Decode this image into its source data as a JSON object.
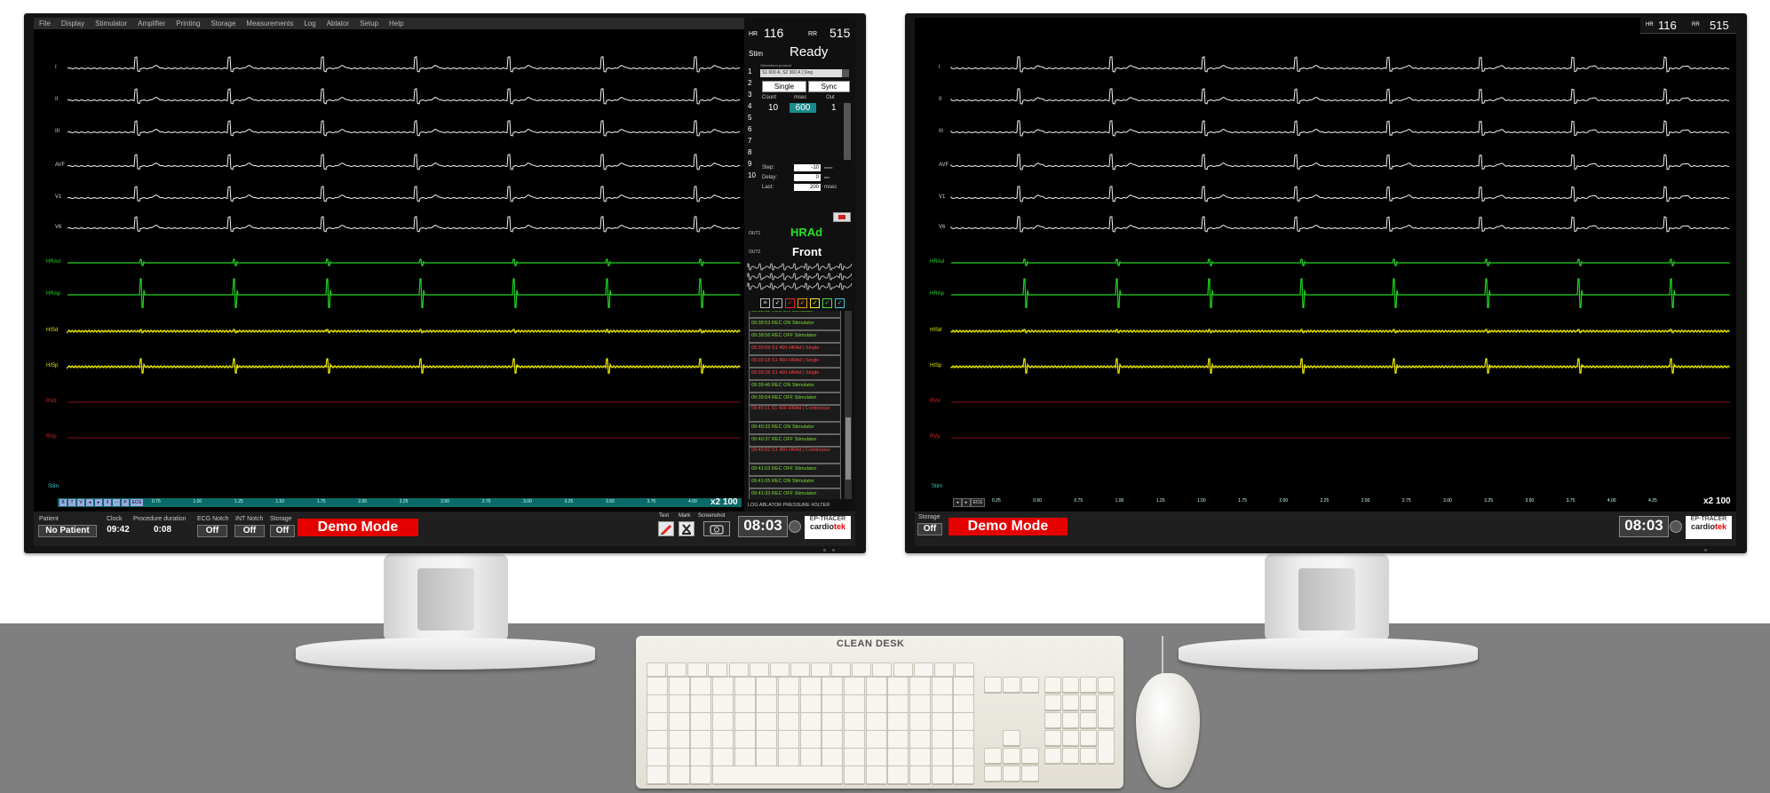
{
  "left_monitor": {
    "menu": [
      "File",
      "Display",
      "Stimulator",
      "Amplifier",
      "Printing",
      "Storage",
      "Measurements",
      "Log",
      "Ablator",
      "Setup",
      "Help"
    ],
    "ecg_channels": [
      "I",
      "II",
      "III",
      "AVF",
      "V1",
      "V6"
    ],
    "ic_channels": [
      {
        "label": "HRAd",
        "color": "green"
      },
      {
        "label": "HRAp",
        "color": "green"
      },
      {
        "label": "HISd",
        "color": "yellow"
      },
      {
        "label": "HISp",
        "color": "yellow"
      },
      {
        "label": "RVd",
        "color": "red"
      },
      {
        "label": "RVp",
        "color": "red"
      }
    ],
    "stim_label": "Stim",
    "timebar_buttons": [
      "B",
      "T",
      "V",
      "◂",
      "▸",
      "‖",
      "⋯",
      "P",
      "ECG"
    ],
    "time_ticks": [
      "0.75",
      "1.00",
      "1.25",
      "1.50",
      "1.75",
      "2.00",
      "2.25",
      "2.50",
      "2.75",
      "3.00",
      "3.25",
      "3.50",
      "3.75",
      "4.00"
    ],
    "zoom": {
      "factor": "x2",
      "value": "100"
    },
    "status": {
      "patient_caption": "Patient",
      "patient_value": "No Patient",
      "clock_caption": "Clock",
      "clock_value": "09:42",
      "duration_caption": "Procedure duration",
      "duration_value": "0:08",
      "ecg_notch_caption": "ECG Notch",
      "ecg_notch_value": "Off",
      "int_notch_caption": "INT Notch",
      "int_notch_value": "Off",
      "storage_caption": "Storage",
      "storage_value": "Off",
      "demo": "Demo Mode",
      "text_caption": "Text",
      "mark_caption": "Mark",
      "screenshot_caption": "Screenshot",
      "time": "08:03",
      "logo_top": "EP-TRACER",
      "logo_brand_a": "cardio",
      "logo_brand_b": "tek"
    },
    "panel": {
      "hr_label": "HR",
      "hr_value": "116",
      "rr_label": "RR",
      "rr_value": "515",
      "stim_label": "Stim",
      "stim_state": "Ready",
      "protocol_caption": "Stimulation protocol",
      "protocol": "S1 600 A, S2 360 A | Sing",
      "single": "Single",
      "sync": "Sync",
      "count_caption": "Count",
      "msec_caption": "msec",
      "out_caption": "Out",
      "count_value": "10",
      "msec_value": "600",
      "out_value": "1",
      "rows": [
        "1",
        "2",
        "3",
        "4",
        "5",
        "6",
        "7",
        "8",
        "9",
        "10"
      ],
      "step_caption": "Step:",
      "step_value": "-10",
      "step_unit": "msec",
      "delay_caption": "Delay:",
      "delay_value": "0",
      "delay_unit": "sec",
      "last_caption": "Last:",
      "last_value": "200",
      "last_unit": "msec",
      "out1_caption": "OUT1",
      "out1_value": "HRAd",
      "out2_caption": "OUT2",
      "out2_value": "Front",
      "tabs": "LOG  ABLATOR  PRESSURE  #OLTER",
      "log": [
        {
          "text": "09:38:53 REC ON Stimulator",
          "color": "green"
        },
        {
          "text": "09:38:56 REC OFF Stimulator",
          "color": "green"
        },
        {
          "text": "09:39:09 S1 400 HRAd | Single",
          "color": "red"
        },
        {
          "text": "09:39:18 S1 400 HRAd | Single",
          "color": "red"
        },
        {
          "text": "09:39:28 S1 400 HRAd | Single",
          "color": "red"
        },
        {
          "text": "09:39:46 REC ON Stimulator",
          "color": "green"
        },
        {
          "text": "09:39:54 REC OFF Stimulator",
          "color": "green"
        },
        {
          "text": "09:40:11 S1 400 HRAd | Continuous",
          "color": "red",
          "double": true
        },
        {
          "text": "09:40:32 REC ON Stimulator",
          "color": "green"
        },
        {
          "text": "09:40:37 REC OFF Stimulator",
          "color": "green"
        },
        {
          "text": "09:40:52 S1 400 HRAd | Continuous",
          "color": "red",
          "double": true
        },
        {
          "text": "09:41:03 REC OFF Stimulator",
          "color": "green"
        },
        {
          "text": "09:41:05 REC ON Stimulator",
          "color": "green"
        },
        {
          "text": "09:41:33 REC OFF Stimulator",
          "color": "green"
        }
      ],
      "log_first_partial": "09:38:11 REC ON Stimulator"
    }
  },
  "right_monitor": {
    "hr_label": "HR",
    "hr_value": "116",
    "rr_label": "RR",
    "rr_value": "515",
    "ecg_channels": [
      "I",
      "II",
      "III",
      "AVF",
      "V1",
      "V6"
    ],
    "ic_channels": [
      {
        "label": "HRAd",
        "color": "green"
      },
      {
        "label": "HRAp",
        "color": "green"
      },
      {
        "label": "HISd",
        "color": "yellow"
      },
      {
        "label": "HISp",
        "color": "yellow"
      },
      {
        "label": "RVd",
        "color": "red"
      },
      {
        "label": "RVp",
        "color": "red"
      }
    ],
    "stim_label": "Stim",
    "timebar_buttons": [
      "◂",
      "▸",
      "ECG"
    ],
    "time_ticks": [
      "0.25",
      "0.50",
      "0.75",
      "1.00",
      "1.25",
      "1.50",
      "1.75",
      "2.00",
      "2.25",
      "2.50",
      "2.75",
      "3.00",
      "3.25",
      "3.50",
      "3.75",
      "4.00",
      "4.25"
    ],
    "zoom": {
      "factor": "x2",
      "value": "100"
    },
    "status": {
      "storage_caption": "Storage",
      "storage_value": "Off",
      "demo": "Demo Mode",
      "time": "08:03",
      "logo_top": "EP-TRACER",
      "logo_brand_a": "cardio",
      "logo_brand_b": "tek"
    }
  },
  "keyboard": {
    "brand": "CLEAN DESK"
  },
  "colors": {
    "ecg": "#f2f2f2",
    "green": "#1fd11f",
    "yellow": "#e6e600",
    "red": "#b01818",
    "demo": "#e50000",
    "timebar": "#0a6a6a"
  }
}
